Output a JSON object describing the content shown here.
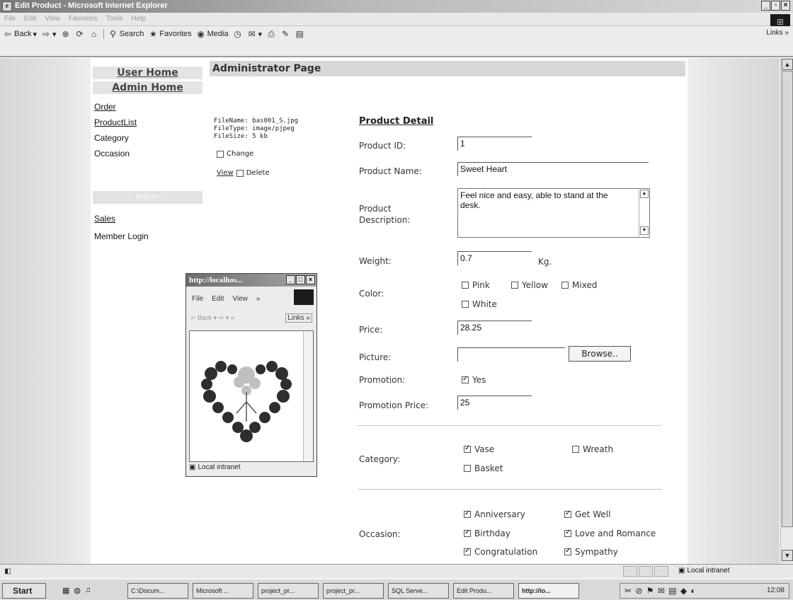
{
  "window": {
    "title": "Edit Product - Microsoft Internet Explorer",
    "controls": [
      "_",
      "▫",
      "×"
    ]
  },
  "menubar": {
    "items": [
      "File",
      "Edit",
      "View",
      "Favorites",
      "Tools",
      "Help"
    ]
  },
  "toolbar": {
    "back": "Back",
    "search": "Search",
    "favorites": "Favorites",
    "media": "Media",
    "links": "Links »"
  },
  "sidebar": {
    "user_home": "User Home",
    "admin_home": "Admin Home",
    "links": [
      "Order",
      "ProductList",
      "Category",
      "Occasion"
    ],
    "report_header": ".:: Report ::.",
    "report_links": [
      "Sales",
      "Member Login"
    ]
  },
  "page": {
    "admin_title": "Administrator Page"
  },
  "file_info": {
    "name": "FileName: bas001_S.jpg",
    "type": "FileType: image/pjpeg",
    "size": "FileSize: 5 kb",
    "change_label": "Change",
    "view_label": "View",
    "delete_label": "Delete"
  },
  "product_detail": {
    "section_title": "Product Detail",
    "product_id_label": "Product ID:",
    "product_id": "1",
    "product_name_label": "Product Name:",
    "product_name": "Sweet Heart",
    "description_label_1": "Product",
    "description_label_2": "Description:",
    "description": "Feel nice and easy, able to stand at the desk.",
    "weight_label": "Weight:",
    "weight": "0.7",
    "weight_unit": "Kg.",
    "color_label": "Color:",
    "colors": [
      {
        "label": "Pink",
        "checked": false
      },
      {
        "label": "Yellow",
        "checked": false
      },
      {
        "label": "Mixed",
        "checked": false
      },
      {
        "label": "White",
        "checked": false
      }
    ],
    "price_label": "Price:",
    "price": "28.25",
    "picture_label": "Picture:",
    "browse_label": "Browse..",
    "promotion_label": "Promotion:",
    "promotion_option": "Yes",
    "promotion_checked": true,
    "promotion_price_label": "Promotion Price:",
    "promotion_price": "25",
    "category_label": "Category:",
    "categories": [
      {
        "label": "Vase",
        "checked": true
      },
      {
        "label": "Wreath",
        "checked": false
      },
      {
        "label": "Basket",
        "checked": false
      }
    ],
    "occasion_label": "Occasion:",
    "occasions": [
      {
        "label": "Anniversary",
        "checked": true
      },
      {
        "label": "Get Well",
        "checked": true
      },
      {
        "label": "Birthday",
        "checked": true
      },
      {
        "label": "Love and Romance",
        "checked": true
      },
      {
        "label": "Congratulation",
        "checked": true
      },
      {
        "label": "Sympathy",
        "checked": true
      }
    ]
  },
  "popup": {
    "title": "http://localhos...",
    "menus": [
      "File",
      "Edit",
      "View",
      "»"
    ],
    "nav": "⇦ Back ▾ ⇨ ▾ »",
    "links": "Links »",
    "status": "Local intranet"
  },
  "statusbar": {
    "zone": "Local intranet"
  },
  "taskbar": {
    "start": "Start",
    "tasks": [
      "C:\\Docum...",
      "Microsoft ...",
      "project_pr...",
      "project_pr...",
      "SQL Serve...",
      "Edit Produ...",
      "http://lo..."
    ],
    "clock": "12:08"
  }
}
